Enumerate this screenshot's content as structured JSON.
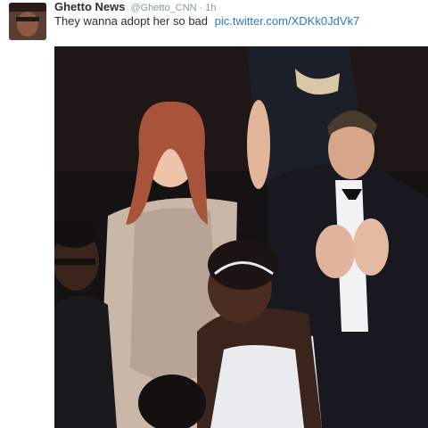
{
  "tweet": {
    "author_name": "Ghetto News",
    "author_handle": "@Ghetto_CNN",
    "separator": "·",
    "timestamp": "1h",
    "text": "They wanna adopt her so bad",
    "link_text": "pic.twitter.com/XDKk0JdVk7",
    "avatar_icon": "user-avatar",
    "colors": {
      "name": "#292f33",
      "meta": "#8899a6",
      "link": "#2b7bb9"
    }
  },
  "media": {
    "type": "photo"
  }
}
